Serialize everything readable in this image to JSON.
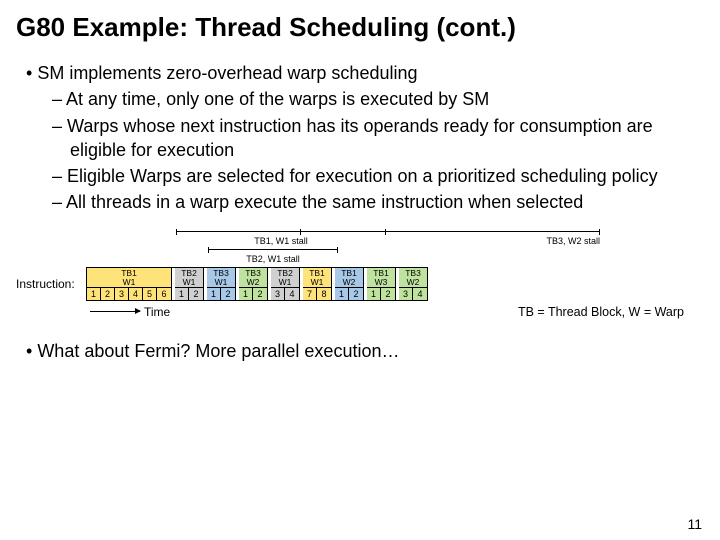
{
  "title": "G80 Example: Thread Scheduling (cont.)",
  "bullet_main": "SM implements zero-overhead warp scheduling",
  "sub_bullets": {
    "a": "At any time, only one of the warps is executed by SM",
    "b": "Warps whose next instruction has its operands ready for consumption are eligible for execution",
    "c": "Eligible Warps are selected for execution on a prioritized scheduling policy",
    "d": "All threads in a warp execute the same instruction when selected"
  },
  "stalls": {
    "s1": "TB1, W1 stall",
    "s2": "TB2, W1 stall",
    "s3": "TB3, W2 stall"
  },
  "instruction_label": "Instruction:",
  "segments": [
    {
      "tb": "TB1",
      "w": "W1",
      "color": "yellow",
      "cells": [
        "1",
        "2",
        "3",
        "4",
        "5",
        "6"
      ]
    },
    {
      "tb": "TB2",
      "w": "W1",
      "color": "gray",
      "cells": [
        "1",
        "2"
      ]
    },
    {
      "tb": "TB3",
      "w": "W1",
      "color": "blue",
      "cells": [
        "1",
        "2"
      ]
    },
    {
      "tb": "TB3",
      "w": "W2",
      "color": "green",
      "cells": [
        "1",
        "2"
      ]
    },
    {
      "tb": "TB2",
      "w": "W1",
      "color": "gray",
      "cells": [
        "3",
        "4"
      ]
    },
    {
      "tb": "TB1",
      "w": "W1",
      "color": "yellow",
      "cells": [
        "7",
        "8"
      ]
    },
    {
      "tb": "TB1",
      "w": "W2",
      "color": "blue",
      "cells": [
        "1",
        "2"
      ]
    },
    {
      "tb": "TB1",
      "w": "W3",
      "color": "green",
      "cells": [
        "1",
        "2"
      ]
    },
    {
      "tb": "TB3",
      "w": "W2",
      "color": "green",
      "cells": [
        "3",
        "4"
      ]
    }
  ],
  "tb_prefix": "TB",
  "w_prefix": "W",
  "time_label": "Time",
  "legend": "TB = Thread Block, W = Warp",
  "bottom": "What about Fermi? More parallel execution…",
  "page": "11"
}
